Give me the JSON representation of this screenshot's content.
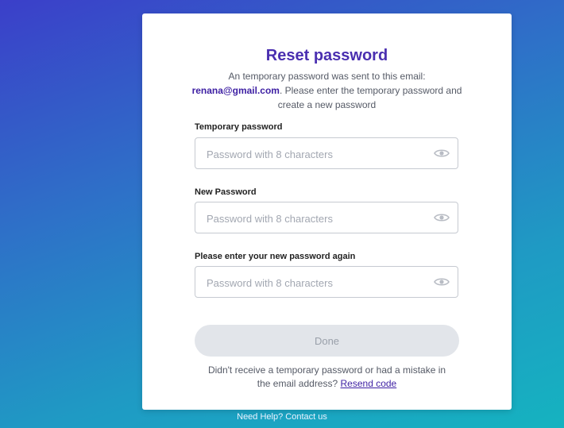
{
  "title": "Reset password",
  "description": {
    "line1": "An temporary password was sent to this email:",
    "email": "renana@gmail.com",
    "line2": ". Please enter the temporary password and create a new password"
  },
  "fields": [
    {
      "label": "Temporary password",
      "placeholder": "Password with 8 characters",
      "value": ""
    },
    {
      "label": "New Password",
      "placeholder": "Password with 8 characters",
      "value": ""
    },
    {
      "label": "Please enter your new password again",
      "placeholder": "Password with 8 characters",
      "value": ""
    }
  ],
  "done_label": "Done",
  "resend": {
    "text": "Didn't receive a temporary password  or had a mistake in the email address?",
    "link": "Resend code"
  },
  "help": "Need Help? Contact us",
  "icons": {
    "visibility": "eye-icon"
  },
  "colors": {
    "accent": "#4a2fb0",
    "button_disabled": "#e2e5ea"
  }
}
